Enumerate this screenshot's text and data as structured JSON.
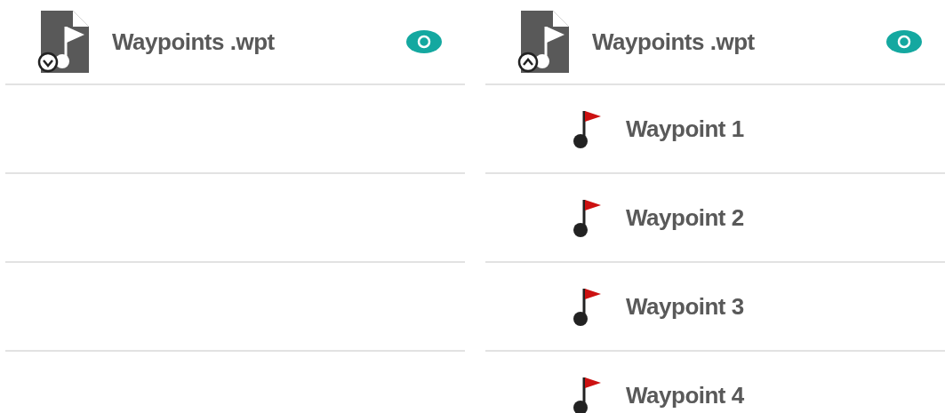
{
  "panels": [
    {
      "file": {
        "name": "Waypoints .wpt",
        "expanded": false,
        "visible": true
      }
    },
    {
      "file": {
        "name": "Waypoints .wpt",
        "expanded": true,
        "visible": true
      },
      "children": [
        {
          "name": "Waypoint 1"
        },
        {
          "name": "Waypoint 2"
        },
        {
          "name": "Waypoint 3"
        },
        {
          "name": "Waypoint 4"
        }
      ]
    }
  ]
}
